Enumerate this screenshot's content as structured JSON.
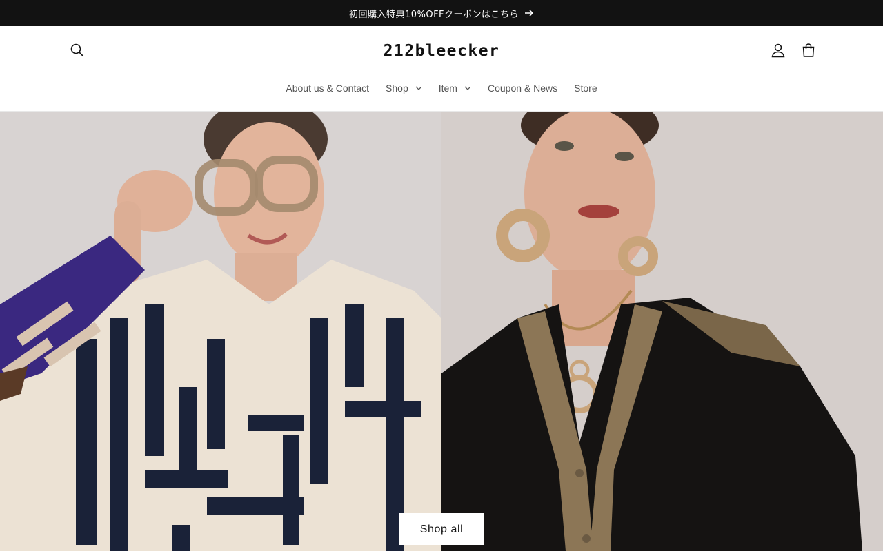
{
  "announcement": {
    "text": "初回購入特典10%OFFクーポンはこちら",
    "icon": "arrow-right-icon"
  },
  "header": {
    "logo": "212bleecker",
    "icons": [
      "search-icon",
      "account-icon",
      "cart-icon"
    ]
  },
  "nav": {
    "items": [
      {
        "label": "About us & Contact",
        "has_dropdown": false
      },
      {
        "label": "Shop",
        "has_dropdown": true
      },
      {
        "label": "Item",
        "has_dropdown": true
      },
      {
        "label": "Coupon & News",
        "has_dropdown": false
      },
      {
        "label": "Store",
        "has_dropdown": false
      }
    ]
  },
  "hero": {
    "button_label": "Shop all"
  },
  "colors": {
    "announcement_bg": "#121212",
    "header_bg": "#ffffff",
    "nav_text": "#555555",
    "button_bg": "#ffffff"
  }
}
